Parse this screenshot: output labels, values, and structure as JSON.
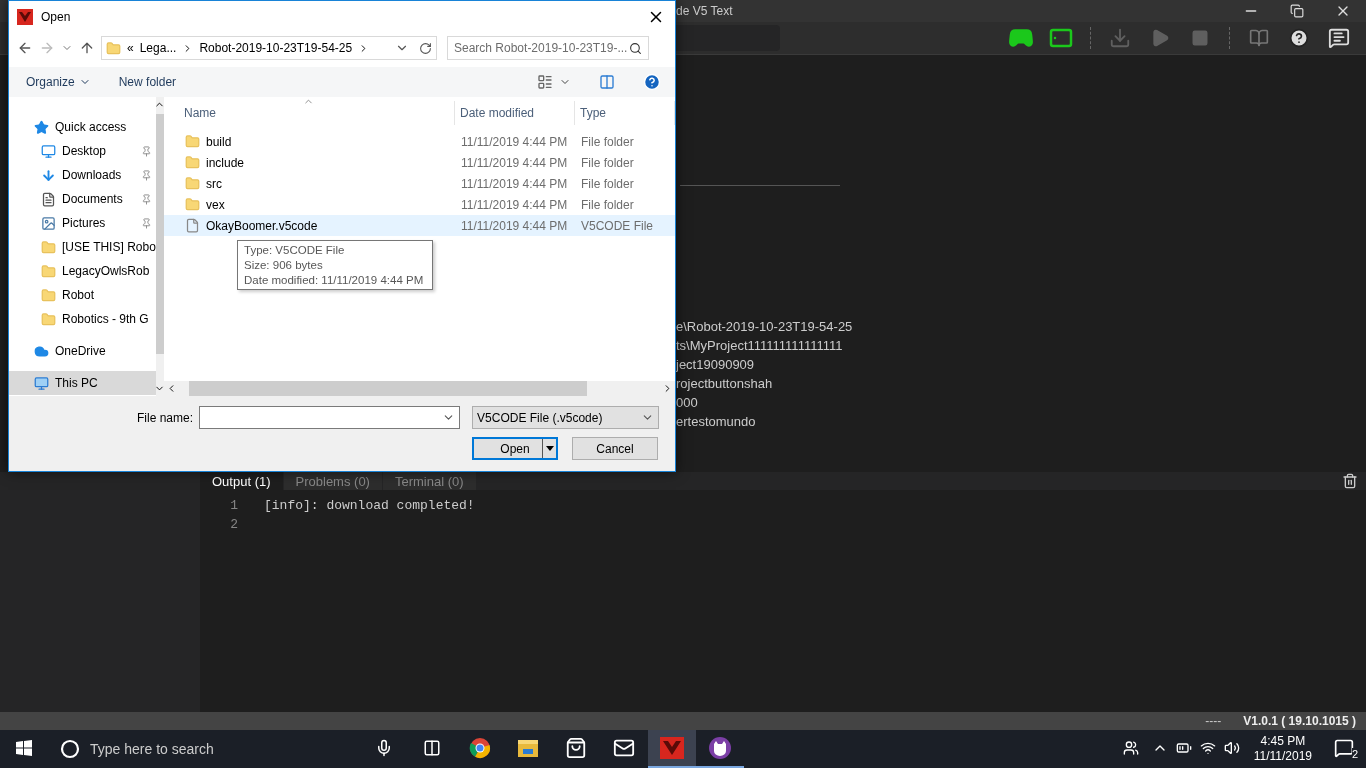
{
  "app": {
    "title": "de V5 Text",
    "devices": [
      {
        "kind": "controller",
        "connected": true
      },
      {
        "kind": "brain",
        "connected": true
      }
    ],
    "actions": [
      {
        "kind": "download",
        "disabled": true
      },
      {
        "kind": "play",
        "disabled": true
      },
      {
        "kind": "stop",
        "disabled": true
      }
    ],
    "project_paths": [
      "e\\Robot-2019-10-23T19-54-25",
      "ts\\MyProject111111111111111",
      "ject19090909",
      "rojectbuttonshah",
      "000",
      "ertestomundo"
    ],
    "output": {
      "tabs": [
        {
          "label": "Output (1)",
          "selected": true
        },
        {
          "label": "Problems (0)",
          "selected": false
        },
        {
          "label": "Terminal (0)",
          "selected": false
        }
      ],
      "lines": [
        {
          "number": "1",
          "text": "[info]: download completed!"
        },
        {
          "number": "2"
        }
      ]
    }
  },
  "status_bar": {
    "left": "----",
    "version": "V1.0.1 ( 19.10.1015 )"
  },
  "dialog": {
    "title": "Open",
    "address": {
      "overflow": "«",
      "crumbs": [
        "Lega...",
        "Robot-2019-10-23T19-54-25"
      ]
    },
    "search": {
      "placeholder": "Search Robot-2019-10-23T19-..."
    },
    "commands": [
      "Organize",
      "New folder"
    ],
    "nav": [
      {
        "label": "Quick access",
        "kind": "star",
        "selected": false,
        "children": [
          {
            "label": "Desktop",
            "kind": "desktop",
            "pinned": true,
            "selected": false
          },
          {
            "label": "Downloads",
            "kind": "download",
            "pinned": true,
            "selected": false
          },
          {
            "label": "Documents",
            "kind": "document",
            "pinned": true,
            "selected": false
          },
          {
            "label": "Pictures",
            "kind": "picture",
            "pinned": true,
            "selected": false
          },
          {
            "label": "[USE THIS] Robo",
            "kind": "folder",
            "pinned": false,
            "selected": false
          },
          {
            "label": "LegacyOwlsRob",
            "kind": "folder",
            "pinned": false,
            "selected": false
          },
          {
            "label": "Robot",
            "kind": "folder",
            "pinned": false,
            "selected": false
          },
          {
            "label": "Robotics - 9th G",
            "kind": "folder",
            "pinned": false,
            "selected": false
          }
        ]
      },
      {
        "label": "OneDrive",
        "kind": "cloud",
        "selected": false
      },
      {
        "label": "This PC",
        "kind": "pc",
        "selected": true
      }
    ],
    "columns": [
      "Name",
      "Date modified",
      "Type"
    ],
    "rows": [
      {
        "name": "build",
        "date": "11/11/2019 4:44 PM",
        "type": "File folder",
        "kind": "folder",
        "selected": false
      },
      {
        "name": "include",
        "date": "11/11/2019 4:44 PM",
        "type": "File folder",
        "kind": "folder",
        "selected": false
      },
      {
        "name": "src",
        "date": "11/11/2019 4:44 PM",
        "type": "File folder",
        "kind": "folder",
        "selected": false
      },
      {
        "name": "vex",
        "date": "11/11/2019 4:44 PM",
        "type": "File folder",
        "kind": "folder",
        "selected": false
      },
      {
        "name": "OkayBoomer.v5code",
        "date": "11/11/2019 4:44 PM",
        "type": "V5CODE File",
        "kind": "file",
        "selected": true
      }
    ],
    "tooltip": [
      "Type: V5CODE File",
      "Size: 906 bytes",
      "Date modified: 11/11/2019 4:44 PM"
    ],
    "file_name_label": "File name:",
    "file_type": "V5CODE File (.v5code)",
    "buttons": [
      "Open",
      "Cancel"
    ]
  },
  "taskbar": {
    "search": {
      "placeholder": "Type here to search"
    },
    "apps": [
      {
        "kind": "chrome",
        "active": false,
        "running": false
      },
      {
        "kind": "explorer",
        "active": false,
        "running": false
      },
      {
        "kind": "store",
        "active": false,
        "running": false
      },
      {
        "kind": "mail",
        "active": false,
        "running": false
      },
      {
        "kind": "vex",
        "active": true,
        "running": true
      },
      {
        "kind": "cat",
        "active": false,
        "running": true
      }
    ],
    "time": "4:45 PM",
    "date": "11/11/2019",
    "notifications": "2"
  }
}
